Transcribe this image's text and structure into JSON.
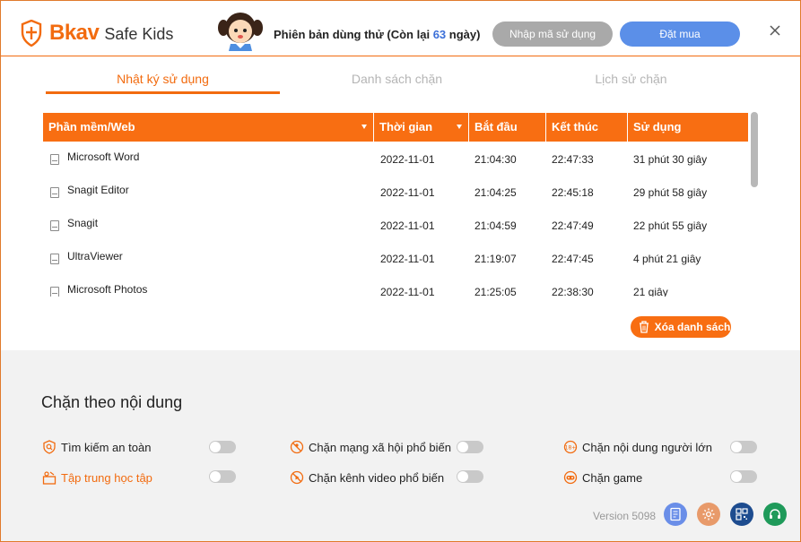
{
  "header": {
    "brand": "Bkav",
    "product": "Safe Kids",
    "trial_prefix": "Phiên bản dùng thử (Còn lại ",
    "trial_days": "63",
    "trial_suffix": " ngày)",
    "enter_code_label": "Nhập mã sử dụng",
    "buy_label": "Đặt mua"
  },
  "tabs": [
    {
      "label": "Nhật ký sử dụng",
      "active": true
    },
    {
      "label": "Danh sách chặn",
      "active": false
    },
    {
      "label": "Lịch sử chặn",
      "active": false
    }
  ],
  "table": {
    "columns": [
      "Phần mềm/Web",
      "Thời gian",
      "Bắt đầu",
      "Kết thúc",
      "Sử dụng"
    ],
    "rows": [
      {
        "app": "Microsoft Word",
        "date": "2022-11-01",
        "start": "21:04:30",
        "end": "22:47:33",
        "usage": "31 phút 30 giây"
      },
      {
        "app": "Snagit Editor",
        "date": "2022-11-01",
        "start": "21:04:25",
        "end": "22:45:18",
        "usage": "29 phút 58 giây"
      },
      {
        "app": "Snagit",
        "date": "2022-11-01",
        "start": "21:04:59",
        "end": "22:47:49",
        "usage": "22 phút 55 giây"
      },
      {
        "app": "UltraViewer",
        "date": "2022-11-01",
        "start": "21:19:07",
        "end": "22:47:45",
        "usage": "4 phút 21 giây"
      },
      {
        "app": "Microsoft Photos",
        "date": "2022-11-01",
        "start": "21:25:05",
        "end": "22:38:30",
        "usage": "21 giây"
      }
    ],
    "clear_label": "Xóa danh sách"
  },
  "content_block": {
    "title": "Chặn theo nội dung",
    "options": [
      {
        "label": "Tìm kiếm an toàn"
      },
      {
        "label": "Chặn mạng xã hội phổ biến"
      },
      {
        "label": "Chặn nội dung người lớn"
      },
      {
        "label": "Tập trung học tập"
      },
      {
        "label": "Chặn kênh video phổ biến"
      },
      {
        "label": "Chặn game"
      }
    ]
  },
  "footer": {
    "version": "Version 5098"
  },
  "colors": {
    "accent": "#f86e12",
    "blue": "#5b8fe8",
    "gray_button": "#a9a9a9"
  }
}
